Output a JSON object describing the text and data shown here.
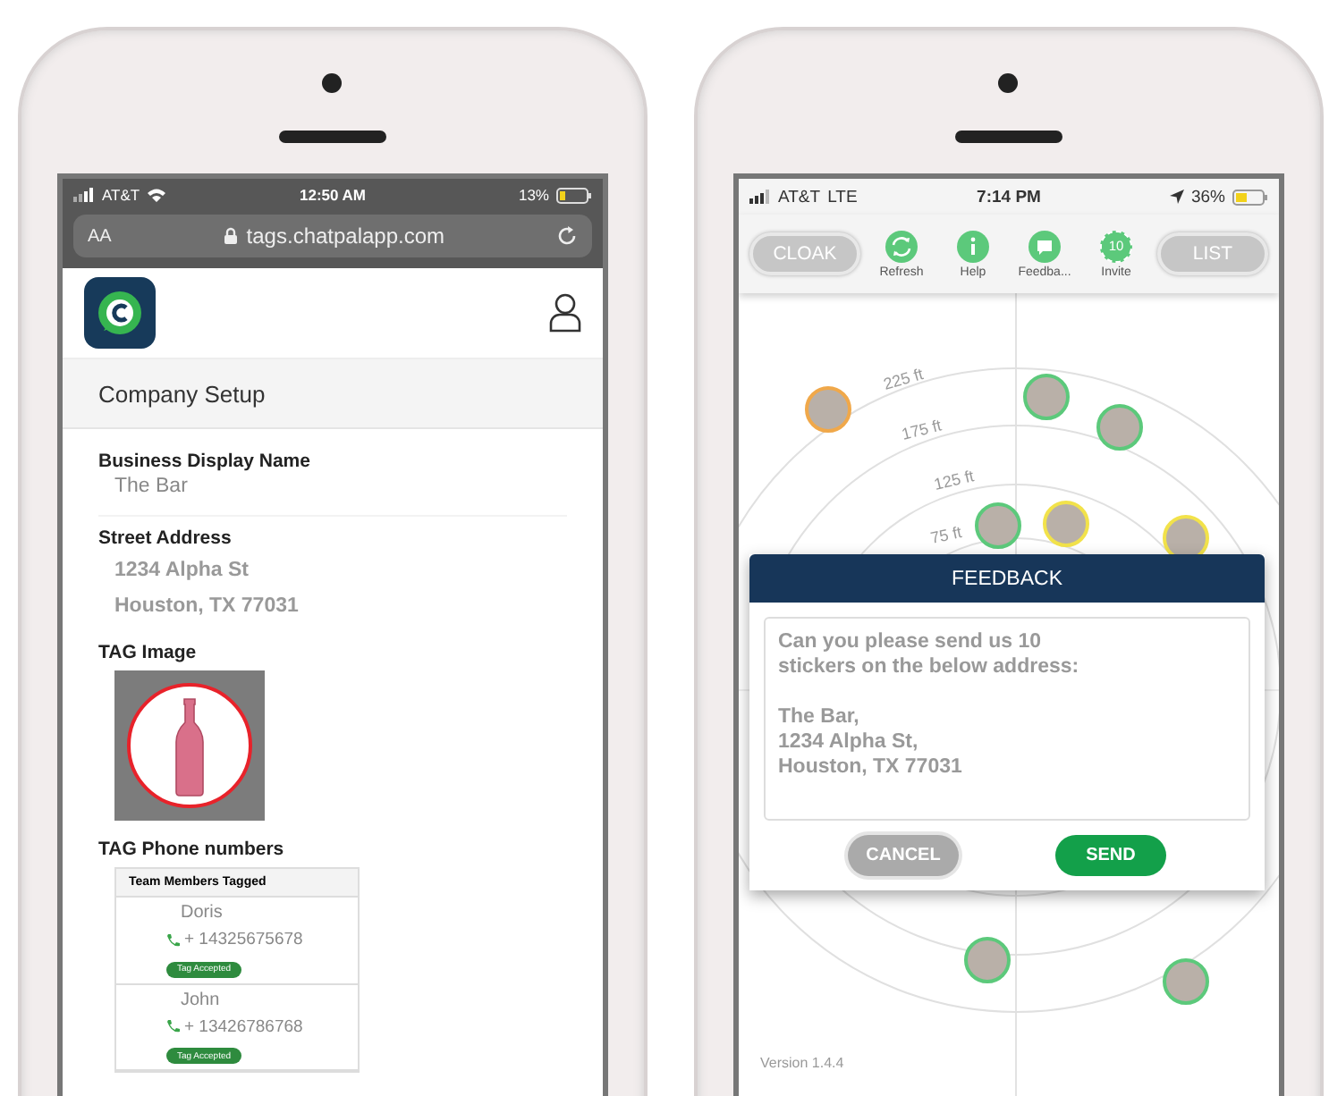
{
  "left_phone": {
    "status_bar": {
      "carrier": "AT&T",
      "time": "12:50 AM",
      "battery": "13%"
    },
    "address_bar": {
      "text_size": "AA",
      "url": "tags.chatpalapp.com"
    },
    "page_title": "Company Setup",
    "fields": [
      {
        "label": "Business Display Name",
        "values": [
          "The Bar"
        ]
      },
      {
        "label": "Street Address",
        "values": [
          "1234 Alpha St",
          "Houston, TX 77031"
        ]
      }
    ],
    "tag_image_label": "TAG Image",
    "tag_phones_label": "TAG Phone numbers",
    "team_table": {
      "header": "Team Members Tagged",
      "rows": [
        {
          "name": "Doris",
          "phone": "+ 14325675678",
          "status": "Tag Accepted"
        },
        {
          "name": "John",
          "phone": "+ 13426786768",
          "status": "Tag Accepted"
        }
      ]
    }
  },
  "right_phone": {
    "status_bar": {
      "carrier": "AT&T",
      "network": "LTE",
      "time": "7:14 PM",
      "battery": "36%"
    },
    "toolbar": {
      "left_button": "CLOAK",
      "right_button": "LIST",
      "items": [
        {
          "kind": "refresh",
          "label": "Refresh"
        },
        {
          "kind": "help",
          "label": "Help"
        },
        {
          "kind": "feedback",
          "label": "Feedba..."
        },
        {
          "kind": "invite",
          "label": "Invite",
          "badge": "10"
        }
      ]
    },
    "radar": {
      "rings": [
        "225 ft",
        "175 ft",
        "125 ft",
        "75 ft"
      ],
      "avatars": [
        {
          "color": "#f0a84a"
        },
        {
          "color": "#5cc97b"
        },
        {
          "color": "#5cc97b"
        },
        {
          "color": "#5cc97b"
        },
        {
          "color": "#f2e24a"
        },
        {
          "color": "#f2e24a"
        },
        {
          "color": "#5cc97b"
        },
        {
          "color": "#5cc97b"
        }
      ],
      "version": "Version 1.4.4"
    },
    "dialog": {
      "title": "FEEDBACK",
      "message": "Can you please send us 10\nstickers on the below address:\n\nThe Bar,\n1234 Alpha St,\nHouston, TX 77031",
      "buttons": [
        {
          "kind": "cancel",
          "label": "CANCEL"
        },
        {
          "kind": "send",
          "label": "SEND"
        }
      ]
    }
  }
}
